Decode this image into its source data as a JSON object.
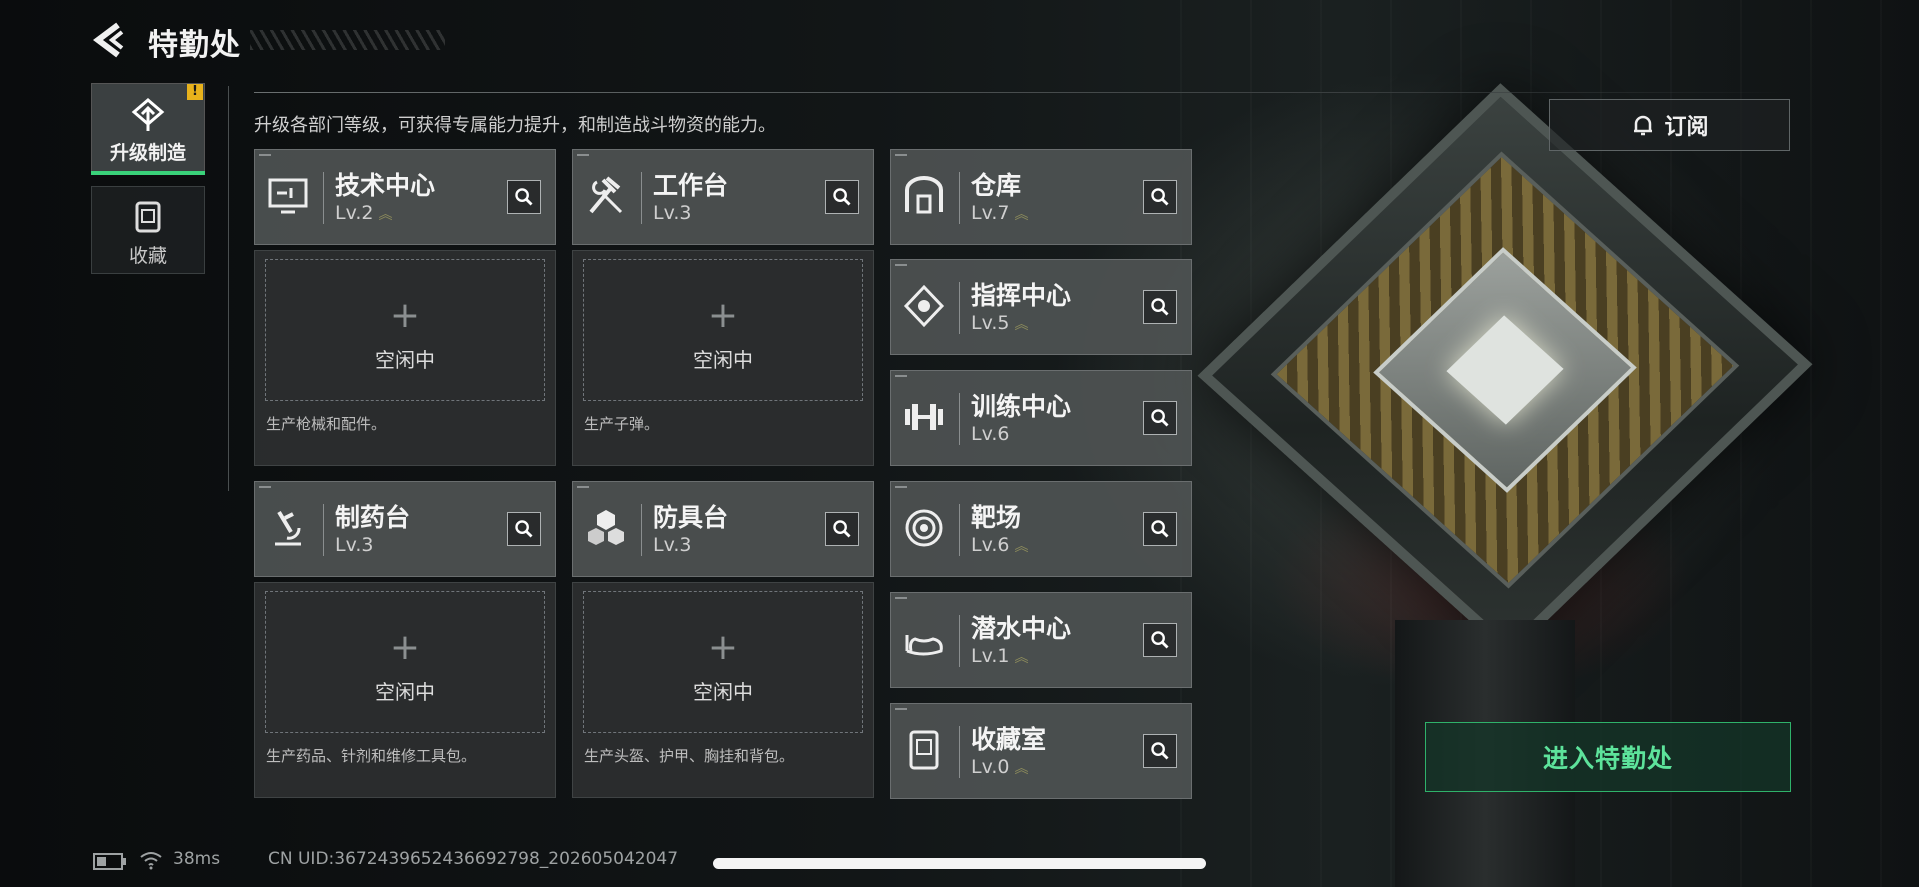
{
  "header": {
    "title": "特勤处"
  },
  "sidebar": {
    "tabs": [
      {
        "label": "升级制造",
        "active": true,
        "badge": "!"
      },
      {
        "label": "收藏",
        "active": false
      }
    ]
  },
  "subtitle": "升级各部门等级，可获得专属能力提升，和制造战斗物资的能力。",
  "departments": {
    "tech": {
      "name": "技术中心",
      "level": "Lv.2",
      "icon": "monitor-icon"
    },
    "workbench": {
      "name": "工作台",
      "level": "Lv.3",
      "icon": "hammer-wrench-icon"
    },
    "warehouse": {
      "name": "仓库",
      "level": "Lv.7",
      "icon": "warehouse-icon"
    },
    "command": {
      "name": "指挥中心",
      "level": "Lv.5",
      "icon": "command-diamond-icon"
    },
    "training": {
      "name": "训练中心",
      "level": "Lv.6",
      "icon": "dumbbell-icon"
    },
    "pharmacy": {
      "name": "制药台",
      "level": "Lv.3",
      "icon": "microscope-icon"
    },
    "armor": {
      "name": "防具台",
      "level": "Lv.3",
      "icon": "cubes-icon"
    },
    "range": {
      "name": "靶场",
      "level": "Lv.6",
      "icon": "target-icon"
    },
    "diving": {
      "name": "潜水中心",
      "level": "Lv.1",
      "icon": "diving-mask-icon"
    },
    "collection": {
      "name": "收藏室",
      "level": "Lv.0",
      "icon": "display-case-icon"
    }
  },
  "slots": {
    "tech": {
      "status": "空闲中",
      "desc": "生产枪械和配件。"
    },
    "workbench": {
      "status": "空闲中",
      "desc": "生产子弹。"
    },
    "pharmacy": {
      "status": "空闲中",
      "desc": "生产药品、针剂和维修工具包。"
    },
    "armor": {
      "status": "空闲中",
      "desc": "生产头盔、护甲、胸挂和背包。"
    }
  },
  "subscribe": {
    "label": "订阅"
  },
  "enter_button": {
    "label": "进入特勤处"
  },
  "statusbar": {
    "ping": "38ms",
    "uid": "CN UID:3672439652436692798_202605042047"
  },
  "colors": {
    "accent": "#3ad27a",
    "badge": "#e8b21c",
    "level_chevron": "#8e8d5c"
  }
}
